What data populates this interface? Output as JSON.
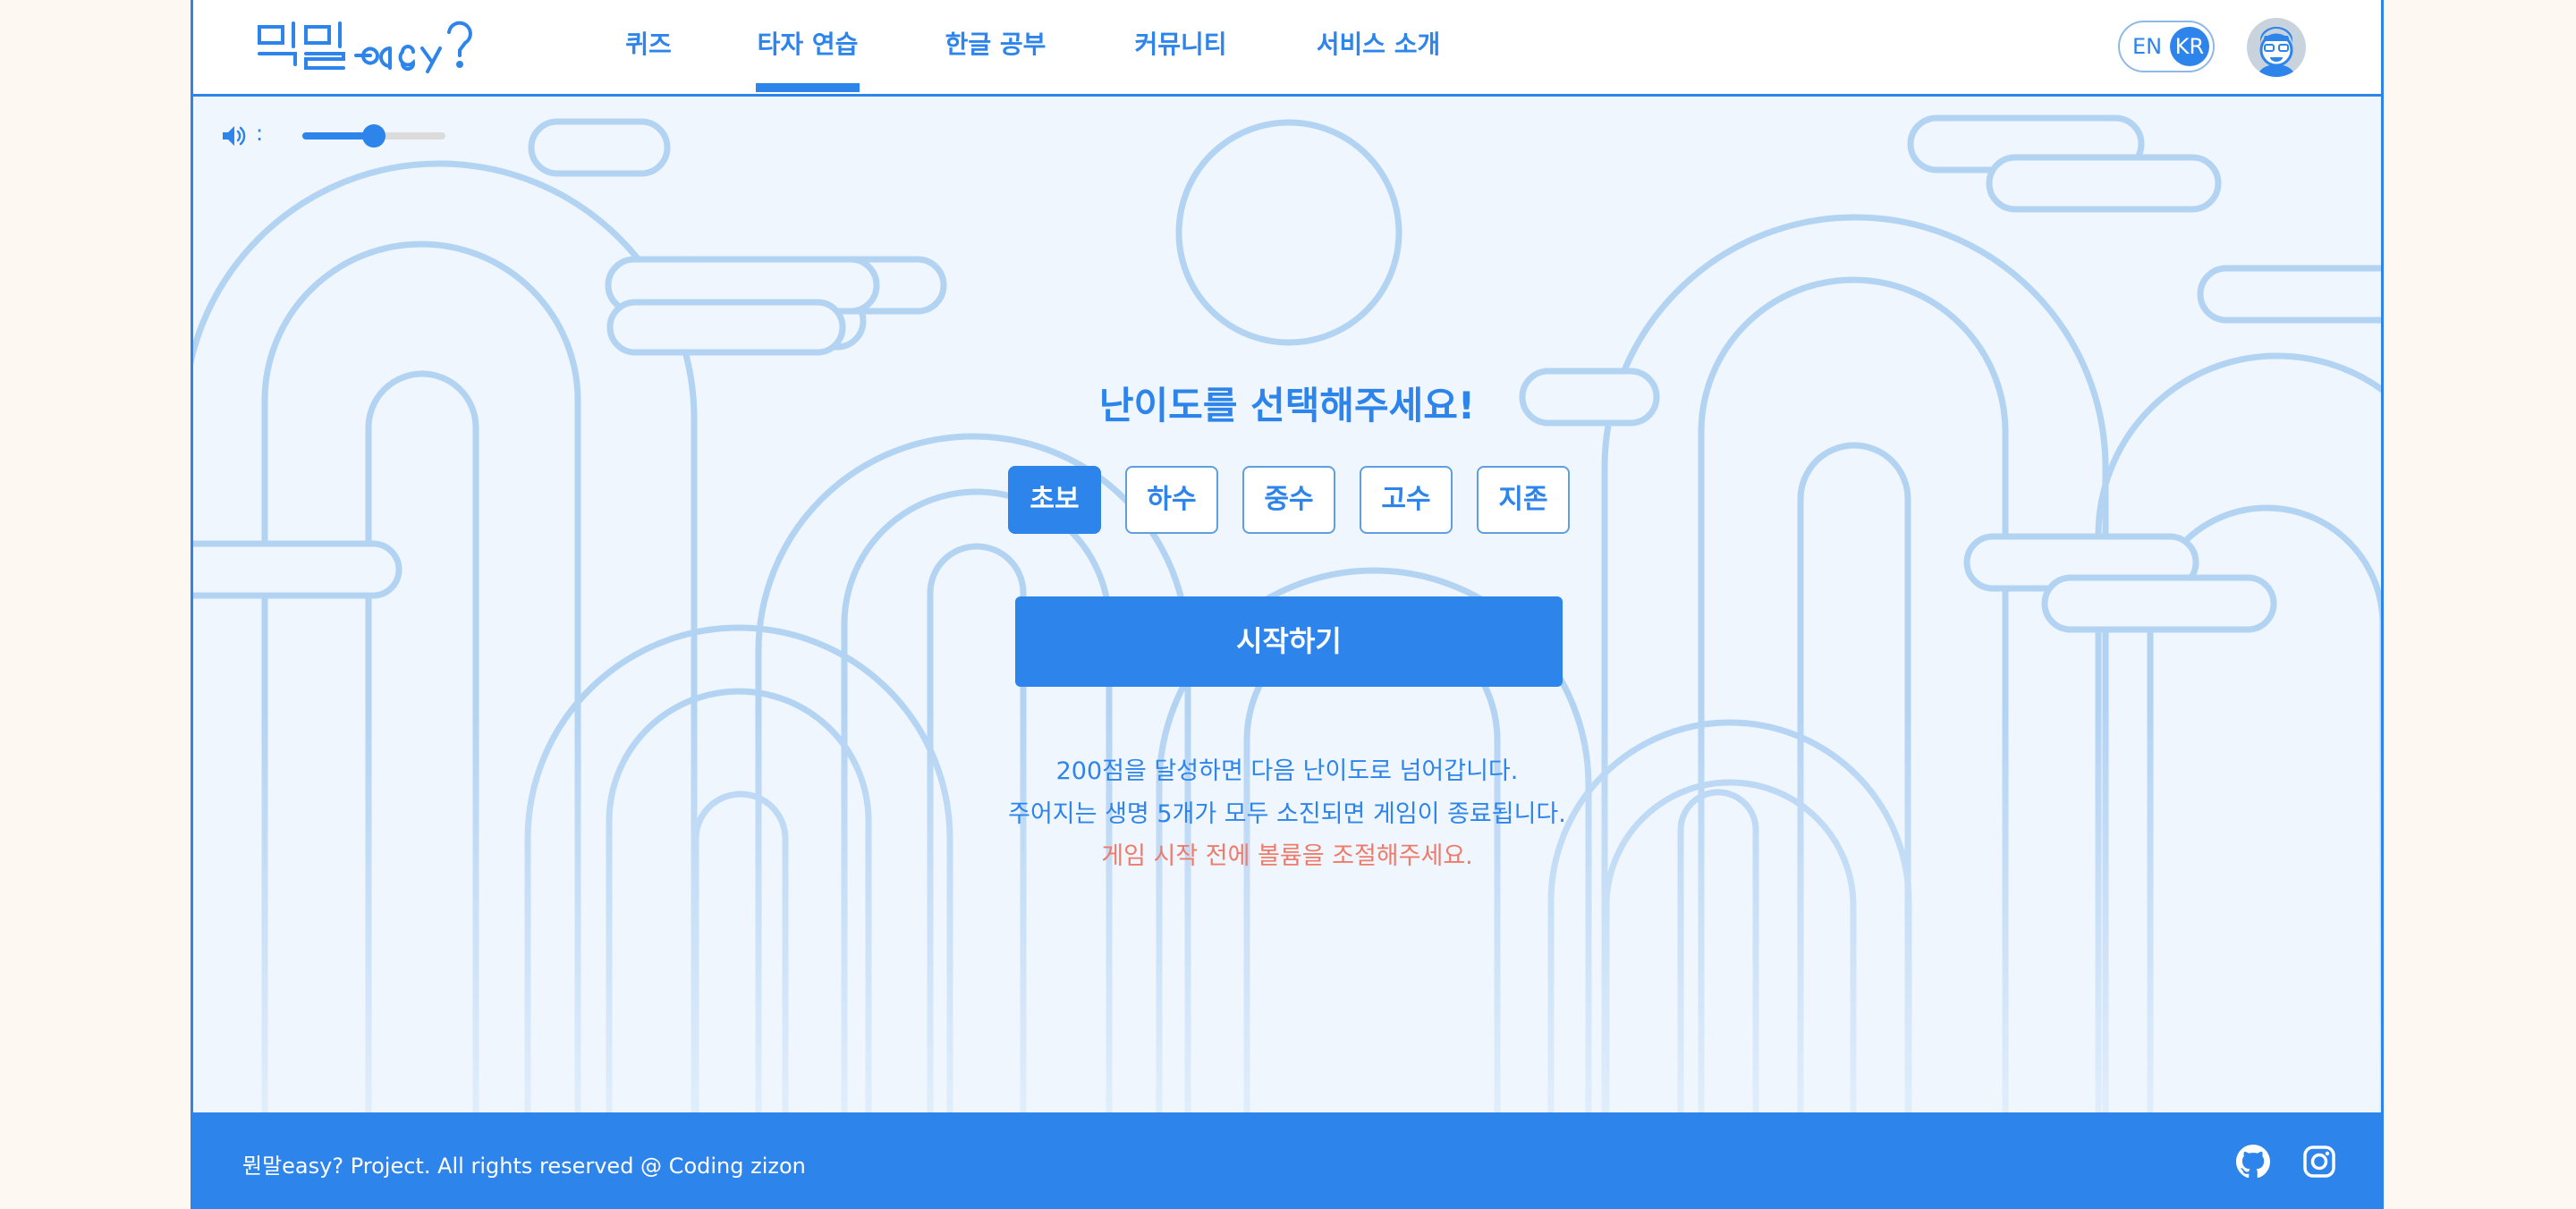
{
  "header": {
    "logo_text": "뭔말easy?",
    "nav": [
      {
        "label": "퀴즈",
        "active": false
      },
      {
        "label": "타자 연습",
        "active": true
      },
      {
        "label": "한글 공부",
        "active": false
      },
      {
        "label": "커뮤니티",
        "active": false
      },
      {
        "label": "서비스 소개",
        "active": false
      }
    ],
    "lang_en": "EN",
    "lang_kr": "KR",
    "lang_selected": "KR"
  },
  "volume": {
    "separator": ":",
    "level_percent": 50
  },
  "main": {
    "title": "난이도를 선택해주세요!",
    "difficulties": [
      "초보",
      "하수",
      "중수",
      "고수",
      "지존"
    ],
    "selected_difficulty": "초보",
    "start_label": "시작하기",
    "info": [
      "200점을 달성하면 다음 난이도로 넘어갑니다.",
      "주어지는 생명 5개가 모두 소진되면 게임이 종료됩니다."
    ],
    "warning": "게임 시작 전에 볼륨을 조절해주세요."
  },
  "footer": {
    "copyright": "뭔말easy? Project. All rights reserved @ Coding zizon"
  },
  "colors": {
    "accent": "#2d84ea",
    "warning": "#ef7b6a",
    "page_background": "#fdf8f2",
    "panel_background": "#eff6fe",
    "decor_stroke": "#b3d3f3"
  }
}
